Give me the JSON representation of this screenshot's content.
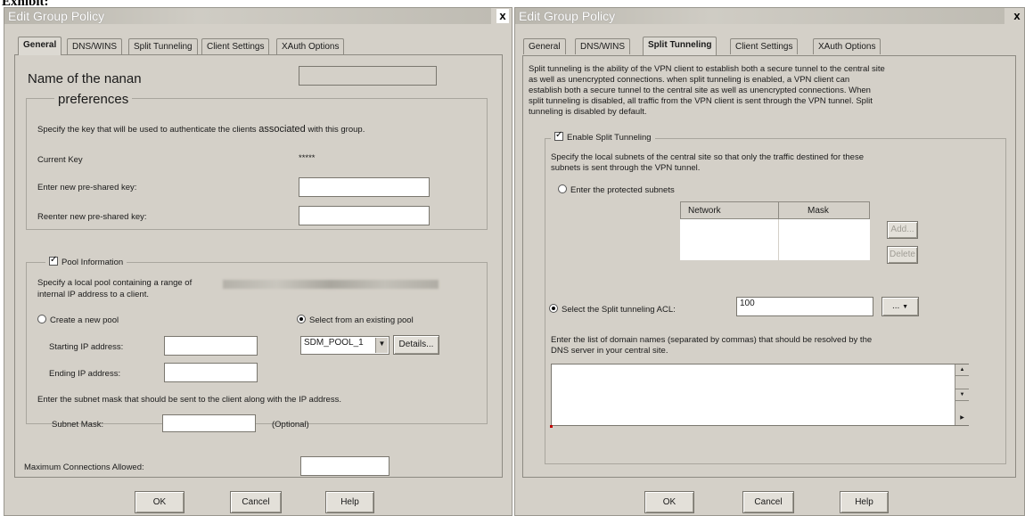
{
  "exhibit_label": "Exhibit:",
  "left": {
    "title": "Edit Group Policy",
    "close": "x",
    "tabs": [
      "General",
      "DNS/WINS",
      "Split Tunneling",
      "Client Settings",
      "XAuth Options"
    ],
    "name_label": "Name of the nanan",
    "preferences_legend": "preferences",
    "key_desc_1": "Specify the key that will be used to authenticate the clients",
    "key_desc_2": "associated",
    "key_desc_3": "with this group.",
    "current_key_label": "Current Key",
    "current_key_value": "*****",
    "new_key_label": "Enter new pre-shared key:",
    "reenter_key_label": "Reenter new pre-shared key:",
    "pool_legend": "Pool Information",
    "pool_desc_1": "Specify a local pool containing a range of",
    "pool_desc_2": "internal IP address to a client.",
    "create_pool_label": "Create a new pool",
    "select_pool_label": "Select from an existing pool",
    "start_ip_label": "Starting IP address:",
    "end_ip_label": "Ending IP address:",
    "pool_select_value": "SDM_POOL_1",
    "details_button": "Details...",
    "subnet_desc": "Enter the subnet mask that should be sent to the client along with the IP address.",
    "subnet_mask_label": "Subnet Mask:",
    "optional_label": "(Optional)",
    "max_conn_label": "Maximum Connections Allowed:",
    "ok_button": "OK",
    "cancel_button": "Cancel",
    "help_button": "Help"
  },
  "right": {
    "title": "Edit Group Policy",
    "close": "x",
    "tabs": [
      "General",
      "DNS/WINS",
      "Split Tunneling",
      "Client Settings",
      "XAuth Options"
    ],
    "intro_1": "Split tunneling is the ability of the VPN client to establish both a secure tunnel to the central site",
    "intro_2": "as well as unencrypted connections. when split tunneling is enabled, a VPN client can",
    "intro_3": "establish both a secure tunnel to the central site as well as unencrypted connections. When",
    "intro_4": "split tunneling is disabled, all traffic from the VPN client is sent through the VPN tunnel. Split",
    "intro_5": "tunneling is disabled by default.",
    "enable_label": "Enable Split Tunneling",
    "subnet_desc_1": "Specify the local subnets of the central site so that only the traffic destined for these",
    "subnet_desc_2": "subnets is sent through the VPN tunnel.",
    "protected_label": "Enter the protected subnets",
    "col_network": "Network",
    "col_mask": "Mask",
    "add_button": "Add...",
    "delete_button": "Delete",
    "acl_label": "Select the Split tunneling ACL:",
    "acl_value": "100",
    "acl_browse": "...",
    "dns_desc_1": "Enter the list of domain names (separated by commas) that should be resolved by the",
    "dns_desc_2": "DNS server in your central site.",
    "ok_button": "OK",
    "cancel_button": "Cancel",
    "help_button": "Help"
  }
}
